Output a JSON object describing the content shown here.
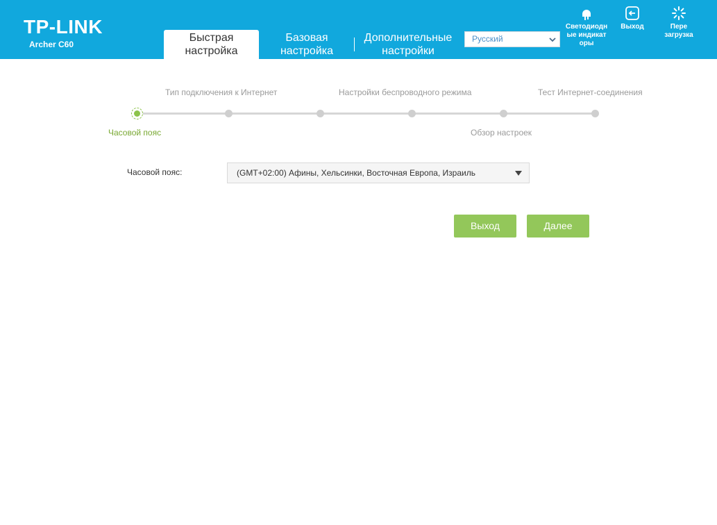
{
  "header": {
    "brand": "TP-LINK",
    "model": "Archer C60",
    "tabs": [
      {
        "label_line1": "Быстрая",
        "label_line2": "настройка",
        "active": true
      },
      {
        "label_line1": "Базовая",
        "label_line2": "настройка",
        "active": false
      },
      {
        "label_line1": "Дополнительные",
        "label_line2": "настройки",
        "active": false
      }
    ],
    "language": {
      "selected": "Русский"
    },
    "buttons": [
      {
        "line1": "Светодиодн",
        "line2": "ые индикат",
        "line3": "оры",
        "icon": "led-icon"
      },
      {
        "line1": "Выход",
        "icon": "logout-icon"
      },
      {
        "line1": "Пере",
        "line2": "загрузка",
        "icon": "reboot-icon"
      }
    ]
  },
  "wizard": {
    "steps_top": [
      "Тип подключения к Интернет",
      "Настройки беспроводного режима",
      "Тест Интернет-соединения"
    ],
    "steps_bottom": [
      "Часовой пояс",
      "Обзор настроек"
    ],
    "active_step": 0
  },
  "form": {
    "timezone_label": "Часовой пояс:",
    "timezone_value": "(GMT+02:00) Афины, Хельсинки, Восточная Европа, Израиль"
  },
  "actions": {
    "exit_label": "Выход",
    "next_label": "Далее"
  },
  "colors": {
    "header_bg": "#11a8dd",
    "accent_green": "#93c75a",
    "active_step_text": "#79a832"
  }
}
